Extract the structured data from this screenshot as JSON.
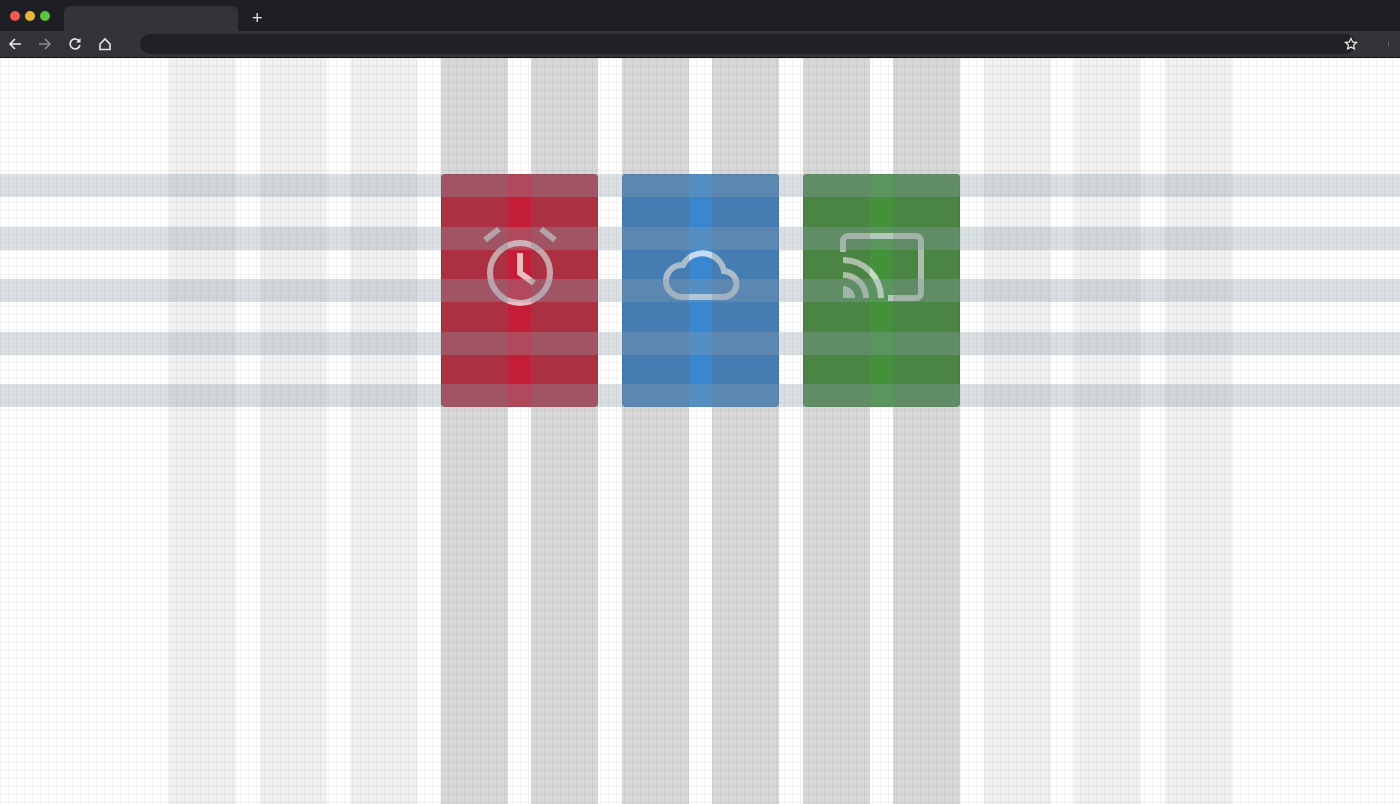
{
  "browser": {
    "new_tab_button": "+"
  },
  "cards": [
    {
      "kind": "alarm",
      "color": "#c41e36"
    },
    {
      "kind": "cloud",
      "color": "#3a86cf"
    },
    {
      "kind": "cast",
      "color": "#43913a"
    }
  ]
}
